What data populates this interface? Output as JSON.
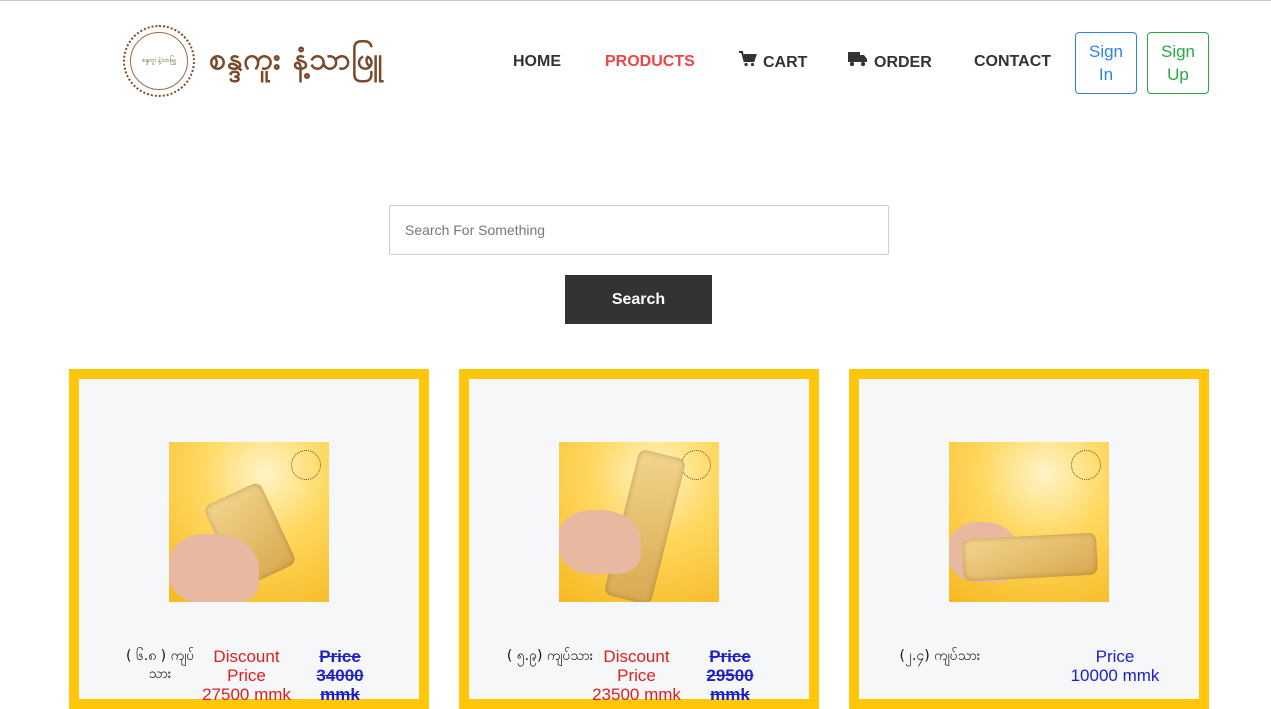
{
  "brand": {
    "logo_text": "စန္ဒကူး နံ့သာဖြူ",
    "seal_text": "စန္ဒကူး နံ့သာဖြူ"
  },
  "nav": {
    "home": "HOME",
    "products": "PRODUCTS",
    "cart": "CART",
    "order": "ORDER",
    "contact": "CONTACT",
    "sign_in": "Sign In",
    "sign_up": "Sign Up"
  },
  "search": {
    "placeholder": "Search For Something",
    "button": "Search"
  },
  "products": [
    {
      "name": "( ၆.၈ ) ကျပ်သား",
      "discount_label": "Discount Price",
      "discount_price": "27500 mmk",
      "old_label": "Price",
      "old_price": "34000 mmk"
    },
    {
      "name": "( ၅.၉) ကျပ်သား",
      "discount_label": "Discount Price",
      "discount_price": "23500 mmk",
      "old_label": "Price",
      "old_price": "29500 mmk"
    },
    {
      "name": "(၂.၄) ကျပ်သား",
      "price_label": "Price",
      "price": "10000 mmk"
    }
  ],
  "colors": {
    "active_nav": "#ef4444",
    "card_border": "#ffc60a",
    "discount": "#e11d1d",
    "old_price": "#1e20c8",
    "sign_in": "#2f80ed",
    "sign_up": "#28a745"
  },
  "icons": {
    "cart": "shopping-cart-icon",
    "order": "truck-icon"
  }
}
